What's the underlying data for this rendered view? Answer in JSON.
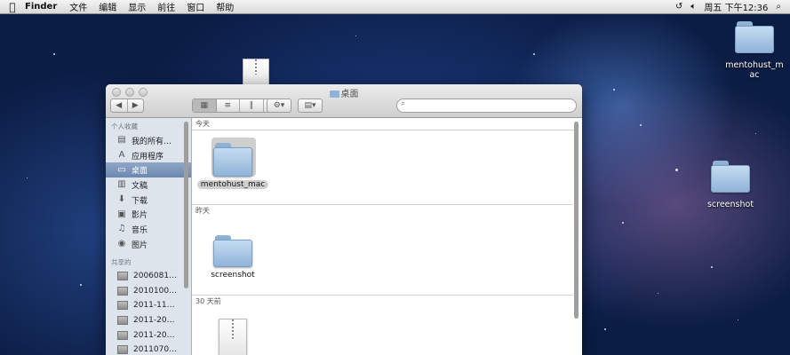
{
  "menubar": {
    "app": "Finder",
    "items": [
      "文件",
      "编辑",
      "显示",
      "前往",
      "窗口",
      "帮助"
    ],
    "clock": "周五 下午12:36"
  },
  "desktop": {
    "icons": [
      {
        "label_line1": "mentohust_m",
        "label_line2": "ac"
      },
      {
        "label": "screenshot"
      }
    ]
  },
  "window": {
    "title": "桌面",
    "search_placeholder": "",
    "sidebar": {
      "favorites_header": "个人收藏",
      "favorites": [
        {
          "label": "我的所有…",
          "icon": "all-files-icon"
        },
        {
          "label": "应用程序",
          "icon": "applications-icon"
        },
        {
          "label": "桌面",
          "icon": "desktop-icon",
          "selected": true
        },
        {
          "label": "文稿",
          "icon": "documents-icon"
        },
        {
          "label": "下载",
          "icon": "downloads-icon"
        },
        {
          "label": "影片",
          "icon": "movies-icon"
        },
        {
          "label": "音乐",
          "icon": "music-icon"
        },
        {
          "label": "图片",
          "icon": "pictures-icon"
        }
      ],
      "shared_header": "共享的",
      "shared": [
        {
          "label": "2006081…"
        },
        {
          "label": "2010100…"
        },
        {
          "label": "2011-11…"
        },
        {
          "label": "2011-20…"
        },
        {
          "label": "2011-20…"
        },
        {
          "label": "2011070…"
        }
      ]
    },
    "sections": [
      {
        "header": "今天",
        "item": "mentohust_mac"
      },
      {
        "header": "昨天",
        "item": "screenshot"
      },
      {
        "header": "30 天前"
      }
    ]
  }
}
